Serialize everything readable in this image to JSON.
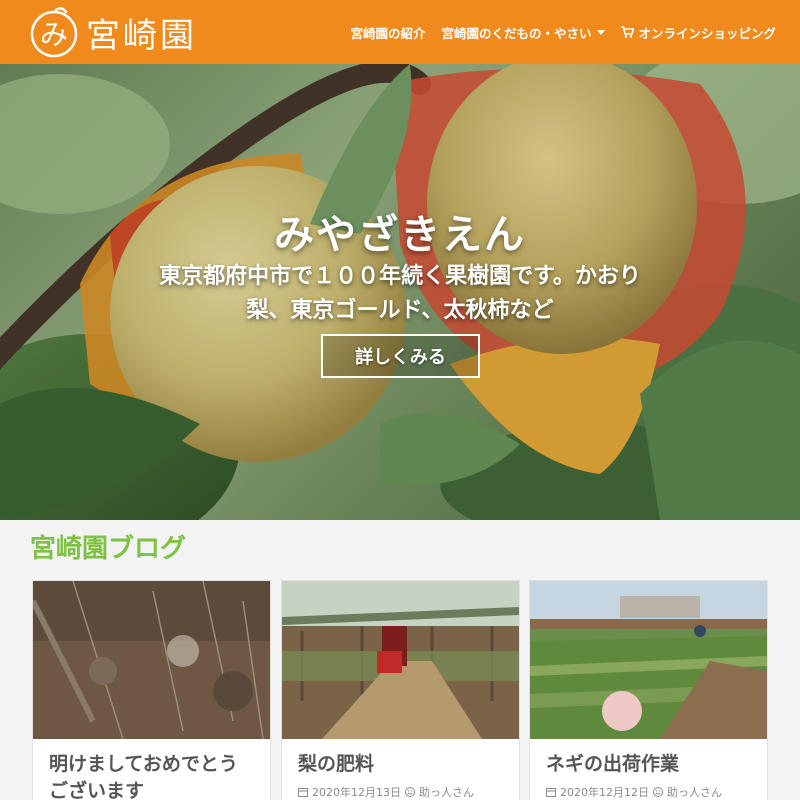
{
  "header": {
    "logo_glyph": "み",
    "logo_text": "宮崎園",
    "nav": [
      {
        "label": "宮崎園の紹介"
      },
      {
        "label": "宮崎園のくだもの・やさい"
      },
      {
        "label": "オンラインショッピング"
      }
    ],
    "colors": {
      "brand": "#f08a1c"
    }
  },
  "hero": {
    "title": "みやざきえん",
    "subtitle": "東京都府中市で１００年続く果樹園です。かおり梨、東京ゴールド、太秋柿など",
    "button_label": "詳しくみる"
  },
  "blog": {
    "heading": "宮崎園ブログ",
    "heading_color": "#7dc242",
    "posts": [
      {
        "title": "明けましておめでとうございます",
        "date": "",
        "author": ""
      },
      {
        "title": "梨の肥料",
        "date": "2020年12月13日",
        "author": "助っ人さん"
      },
      {
        "title": "ネギの出荷作業",
        "date": "2020年12月12日",
        "author": "助っ人さん"
      }
    ]
  }
}
